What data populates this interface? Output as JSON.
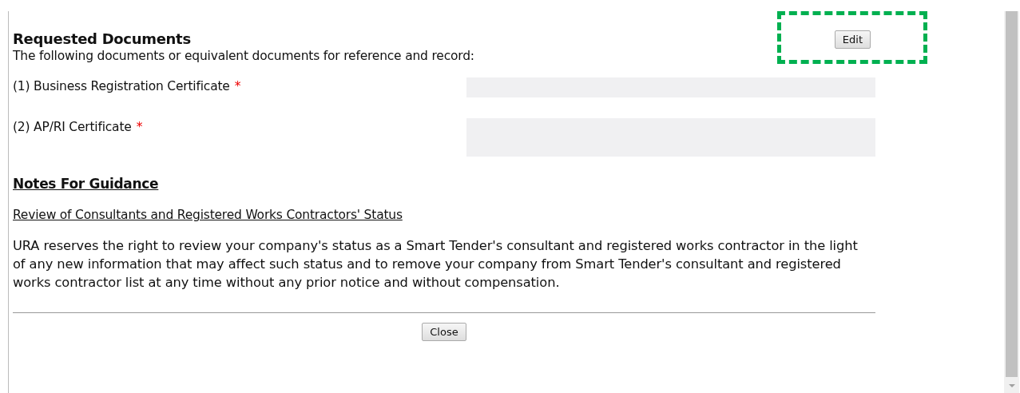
{
  "section": {
    "title": "Requested Documents",
    "subtitle": "The following documents or equivalent documents for reference and record:",
    "edit_button": "Edit",
    "edit_highlighted": true
  },
  "documents": [
    {
      "label": "(1) Business Registration Certificate",
      "required_mark": "*",
      "kind": "single-line"
    },
    {
      "label": "(2) AP/RI Certificate",
      "required_mark": "*",
      "kind": "multi-line"
    }
  ],
  "notes": {
    "title": "Notes For Guidance",
    "subheading": "Review of Consultants and Registered Works Contractors' Status",
    "body": "URA reserves the right to review your company's status as a Smart Tender's consultant and registered works contractor in the light of any new information that may affect such status and to remove your company from Smart Tender's consultant and registered works contractor list at any time without any prior notice and without compensation."
  },
  "close_button": "Close"
}
